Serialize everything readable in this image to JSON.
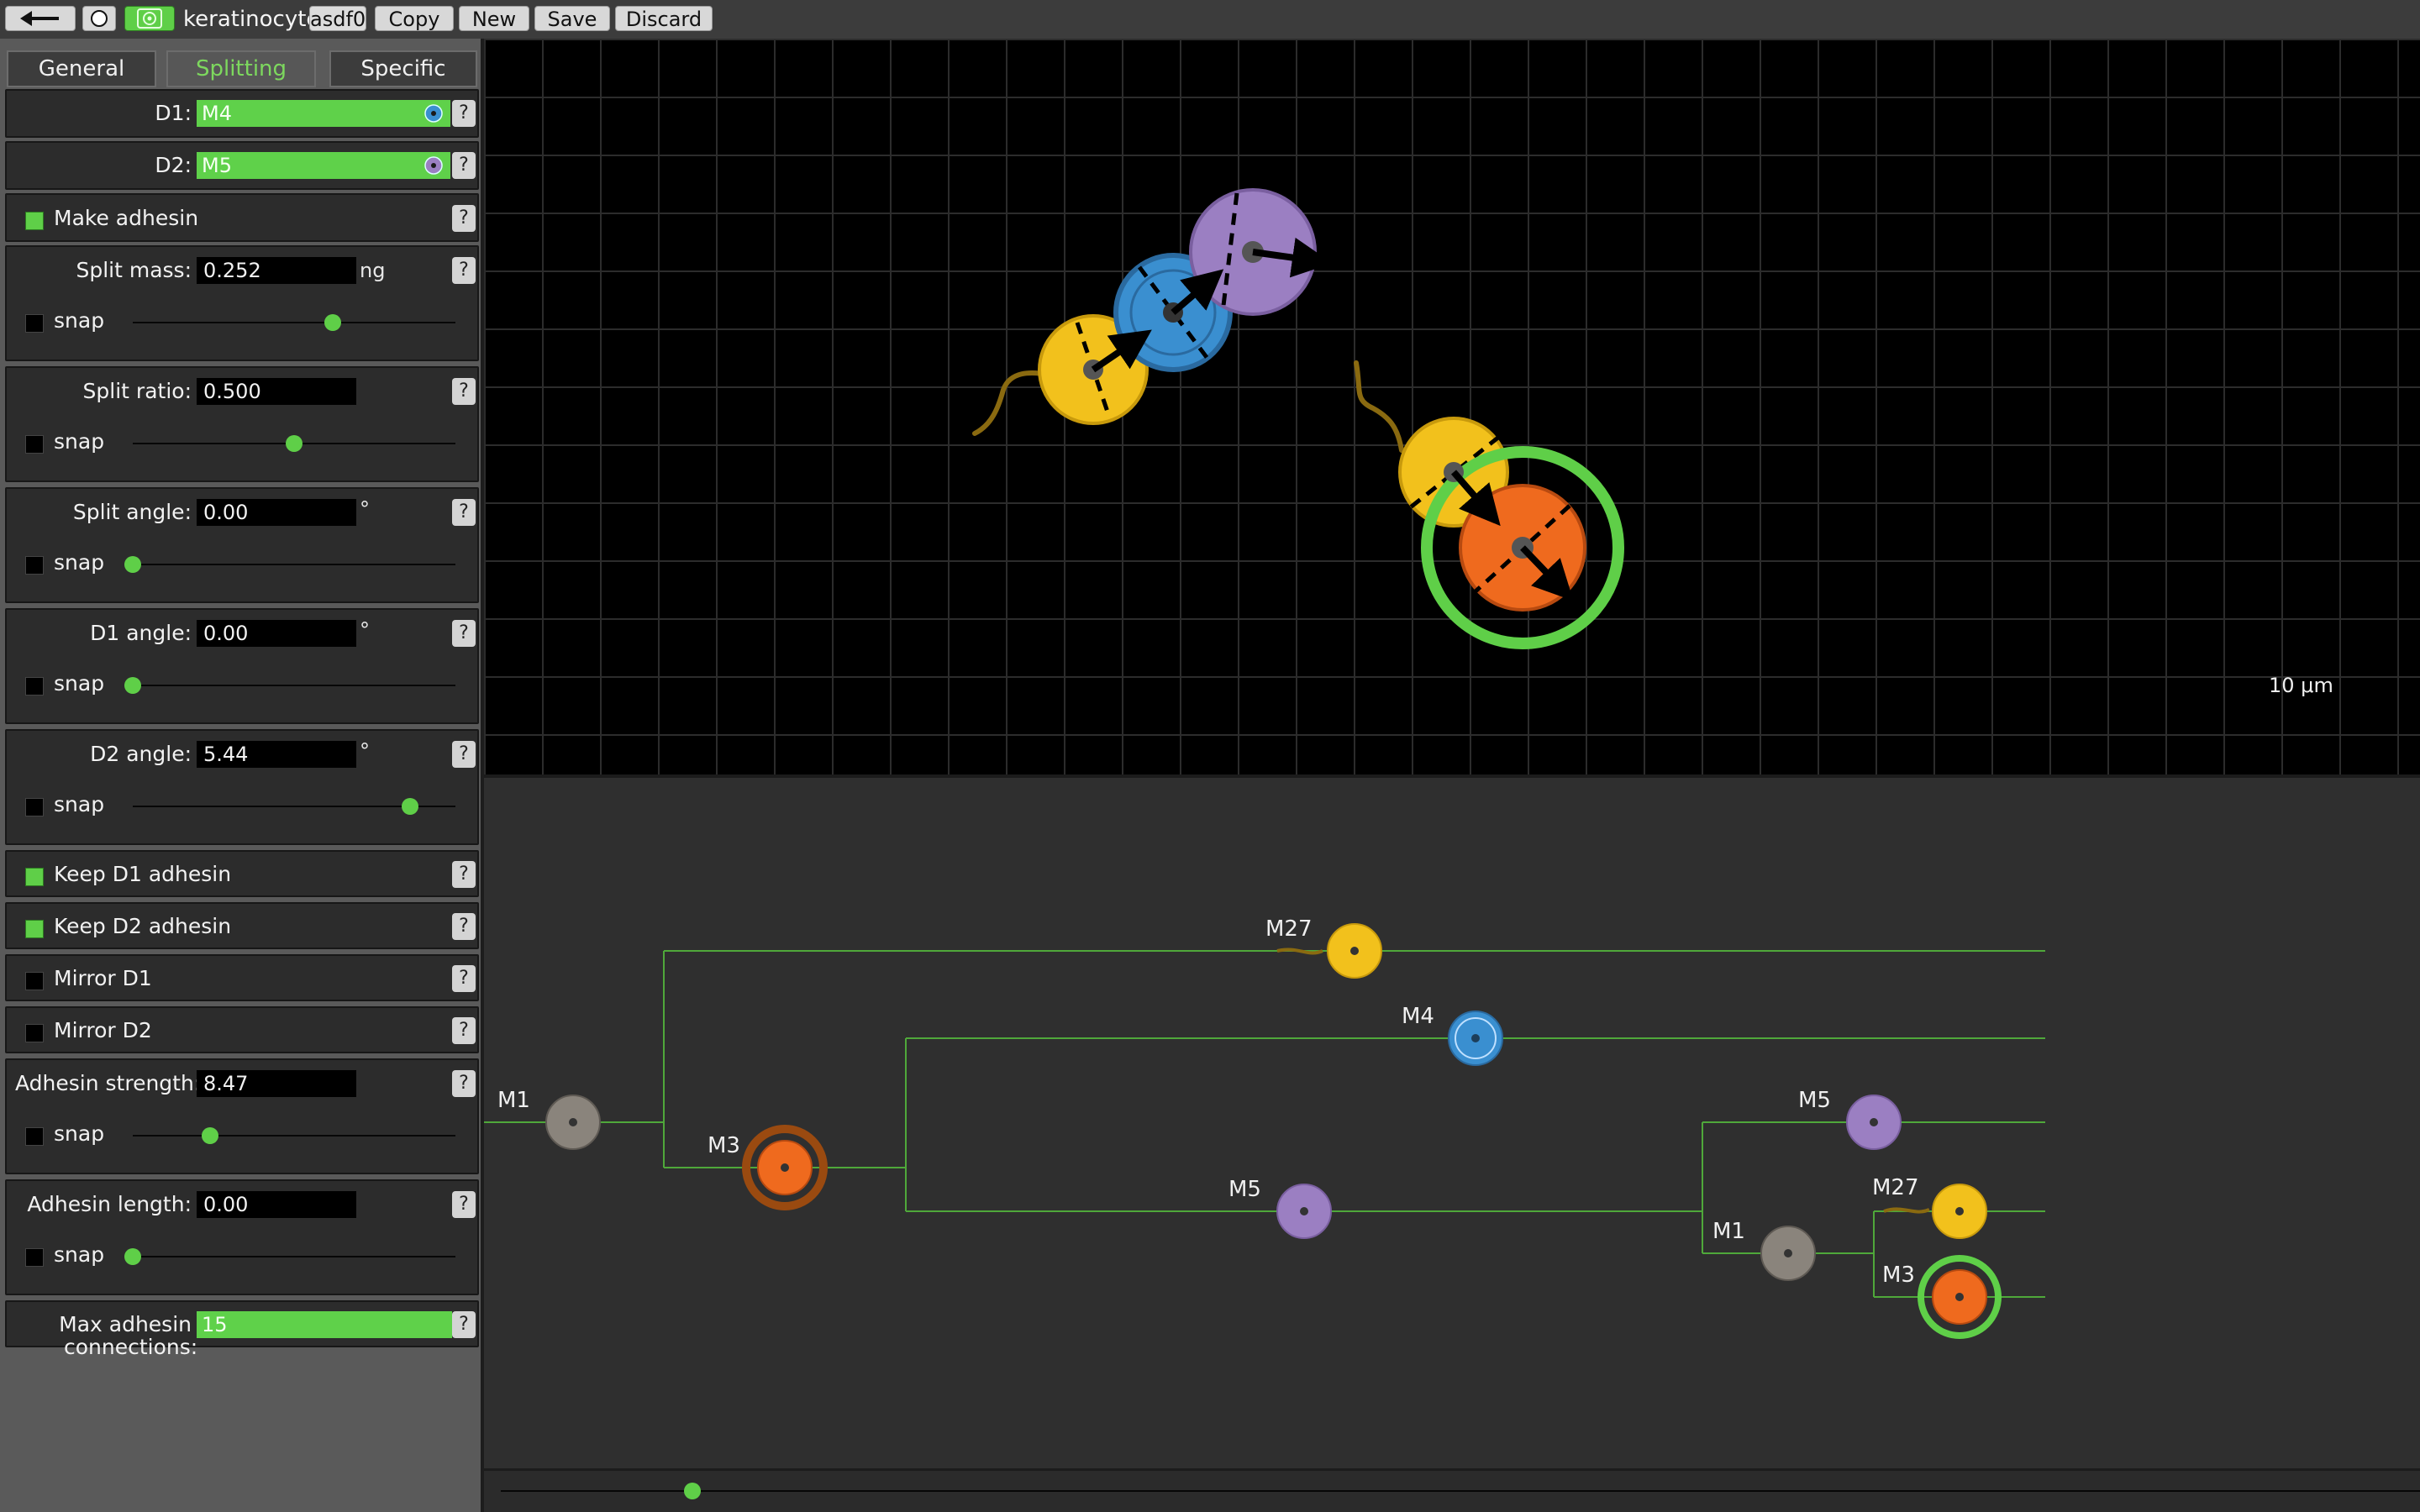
{
  "topbar": {
    "back_icon": "arrow-left-icon",
    "circle_icon": "circle-icon",
    "cell_icon": "cell-icon",
    "cell_type_name": "keratinocyte",
    "genome_name": "asdf0",
    "copy_label": "Copy",
    "new_label": "New",
    "save_label": "Save",
    "discard_label": "Discard"
  },
  "tabs": [
    {
      "label": "General",
      "active": false
    },
    {
      "label": "Splitting",
      "active": true
    },
    {
      "label": "Specific",
      "active": false
    }
  ],
  "panel": {
    "d1_label": "D1:",
    "d1_value": "M4",
    "d1_color": "#3a8fd0",
    "d2_label": "D2:",
    "d2_value": "M5",
    "d2_color": "#9b7fc2",
    "make_adhesin_label": "Make adhesin",
    "make_adhesin_checked": true,
    "split_mass_label": "Split mass:",
    "split_mass_value": "0.252",
    "split_mass_unit": "ng",
    "split_mass_slider": 0.62,
    "split_ratio_label": "Split ratio:",
    "split_ratio_value": "0.500",
    "split_ratio_slider": 0.5,
    "split_angle_label": "Split angle:",
    "split_angle_value": "0.00",
    "split_angle_unit": "°",
    "split_angle_slider": 0.0,
    "d1_angle_label": "D1 angle:",
    "d1_angle_value": "0.00",
    "d1_angle_unit": "°",
    "d1_angle_slider": 0.0,
    "d2_angle_label": "D2 angle:",
    "d2_angle_value": "5.44",
    "d2_angle_unit": "°",
    "d2_angle_slider": 0.86,
    "keep_d1_adhesin_label": "Keep D1 adhesin",
    "keep_d1_adhesin_checked": true,
    "keep_d2_adhesin_label": "Keep D2 adhesin",
    "keep_d2_adhesin_checked": true,
    "mirror_d1_label": "Mirror D1",
    "mirror_d1_checked": false,
    "mirror_d2_label": "Mirror D2",
    "mirror_d2_checked": false,
    "adhesin_strength_label": "Adhesin strength:",
    "adhesin_strength_value": "8.47",
    "adhesin_strength_slider": 0.24,
    "adhesin_length_label": "Adhesin length:",
    "adhesin_length_value": "0.00",
    "adhesin_length_slider": 0.0,
    "max_adhesin_label_1": "Max adhesin",
    "max_adhesin_label_2": "connections:",
    "max_adhesin_value": "15",
    "snap_label": "snap",
    "help_label": "?"
  },
  "viewport": {
    "scale_label": "10 μm"
  },
  "tree": {
    "labels": {
      "root_m1": "M1",
      "m3_a": "M3",
      "m27_a": "M27",
      "m4": "M4",
      "m5_a": "M5",
      "m5_b": "M5",
      "m1_b": "M1",
      "m27_b": "M27",
      "m3_b": "M3"
    },
    "colors": {
      "m1": "#8a847c",
      "m3": "#ef6a1e",
      "m27": "#f2c11c",
      "m4": "#3a8fd0",
      "m5": "#9b7fc2",
      "line": "#4fa83a",
      "highlight": "#5fcf48"
    }
  },
  "timeline": {
    "position": 0.1
  }
}
